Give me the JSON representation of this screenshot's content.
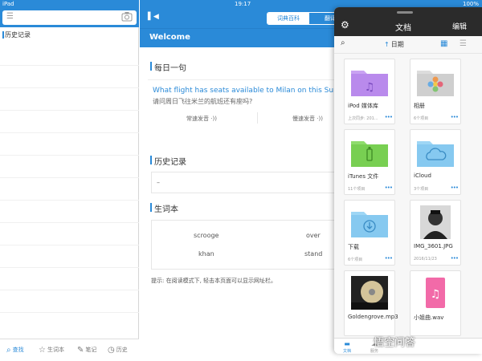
{
  "status_bar": {
    "device": "iPad",
    "time": "19:17",
    "battery": "100%"
  },
  "sidebar": {
    "history_label": "历史记录",
    "tabs": [
      {
        "label": "查找",
        "icon": "search-icon"
      },
      {
        "label": "生词本",
        "icon": "star-icon"
      },
      {
        "label": "笔记",
        "icon": "pencil-icon"
      },
      {
        "label": "历史",
        "icon": "clock-icon"
      }
    ]
  },
  "main": {
    "segments": [
      "词典百科",
      "翻译"
    ],
    "welcome": "Welcome",
    "daily_title": "每日一句",
    "daily_en": "What flight has seats available to Milan on this Sunday",
    "daily_zh": "请问周日飞往米兰的航班还有座吗?",
    "play_normal": "常速发音",
    "play_slow": "慢速发音",
    "history_title": "历史记录",
    "history_item": "–",
    "vocab_title": "生词本",
    "words": [
      "scrooge",
      "over",
      "khan",
      "stand"
    ],
    "hint": "提示: 在阅读模式下, 轻击本页面可以显示网址栏。"
  },
  "files": {
    "title": "文档",
    "edit": "编辑",
    "sort_label": "日期",
    "items": [
      {
        "name": "iPod 媒体库",
        "sub": "上次同步: 201..."
      },
      {
        "name": "相册",
        "sub": "6个项目"
      },
      {
        "name": "iTunes 文件",
        "sub": "11个项目"
      },
      {
        "name": "iCloud",
        "sub": "3个项目"
      },
      {
        "name": "下载",
        "sub": "6个项目"
      },
      {
        "name": "IMG_3601.JPG",
        "sub": "2016/11/23"
      },
      {
        "name": "Goldengrove.mp3",
        "sub": ""
      },
      {
        "name": "小姐曲.wav",
        "sub": ""
      }
    ],
    "footer": [
      {
        "label": "文档"
      },
      {
        "label": "服务"
      }
    ]
  },
  "watermark": "悟空问答",
  "colors": {
    "accent": "#2a8ad8",
    "files_header": "#2b2b2b"
  }
}
